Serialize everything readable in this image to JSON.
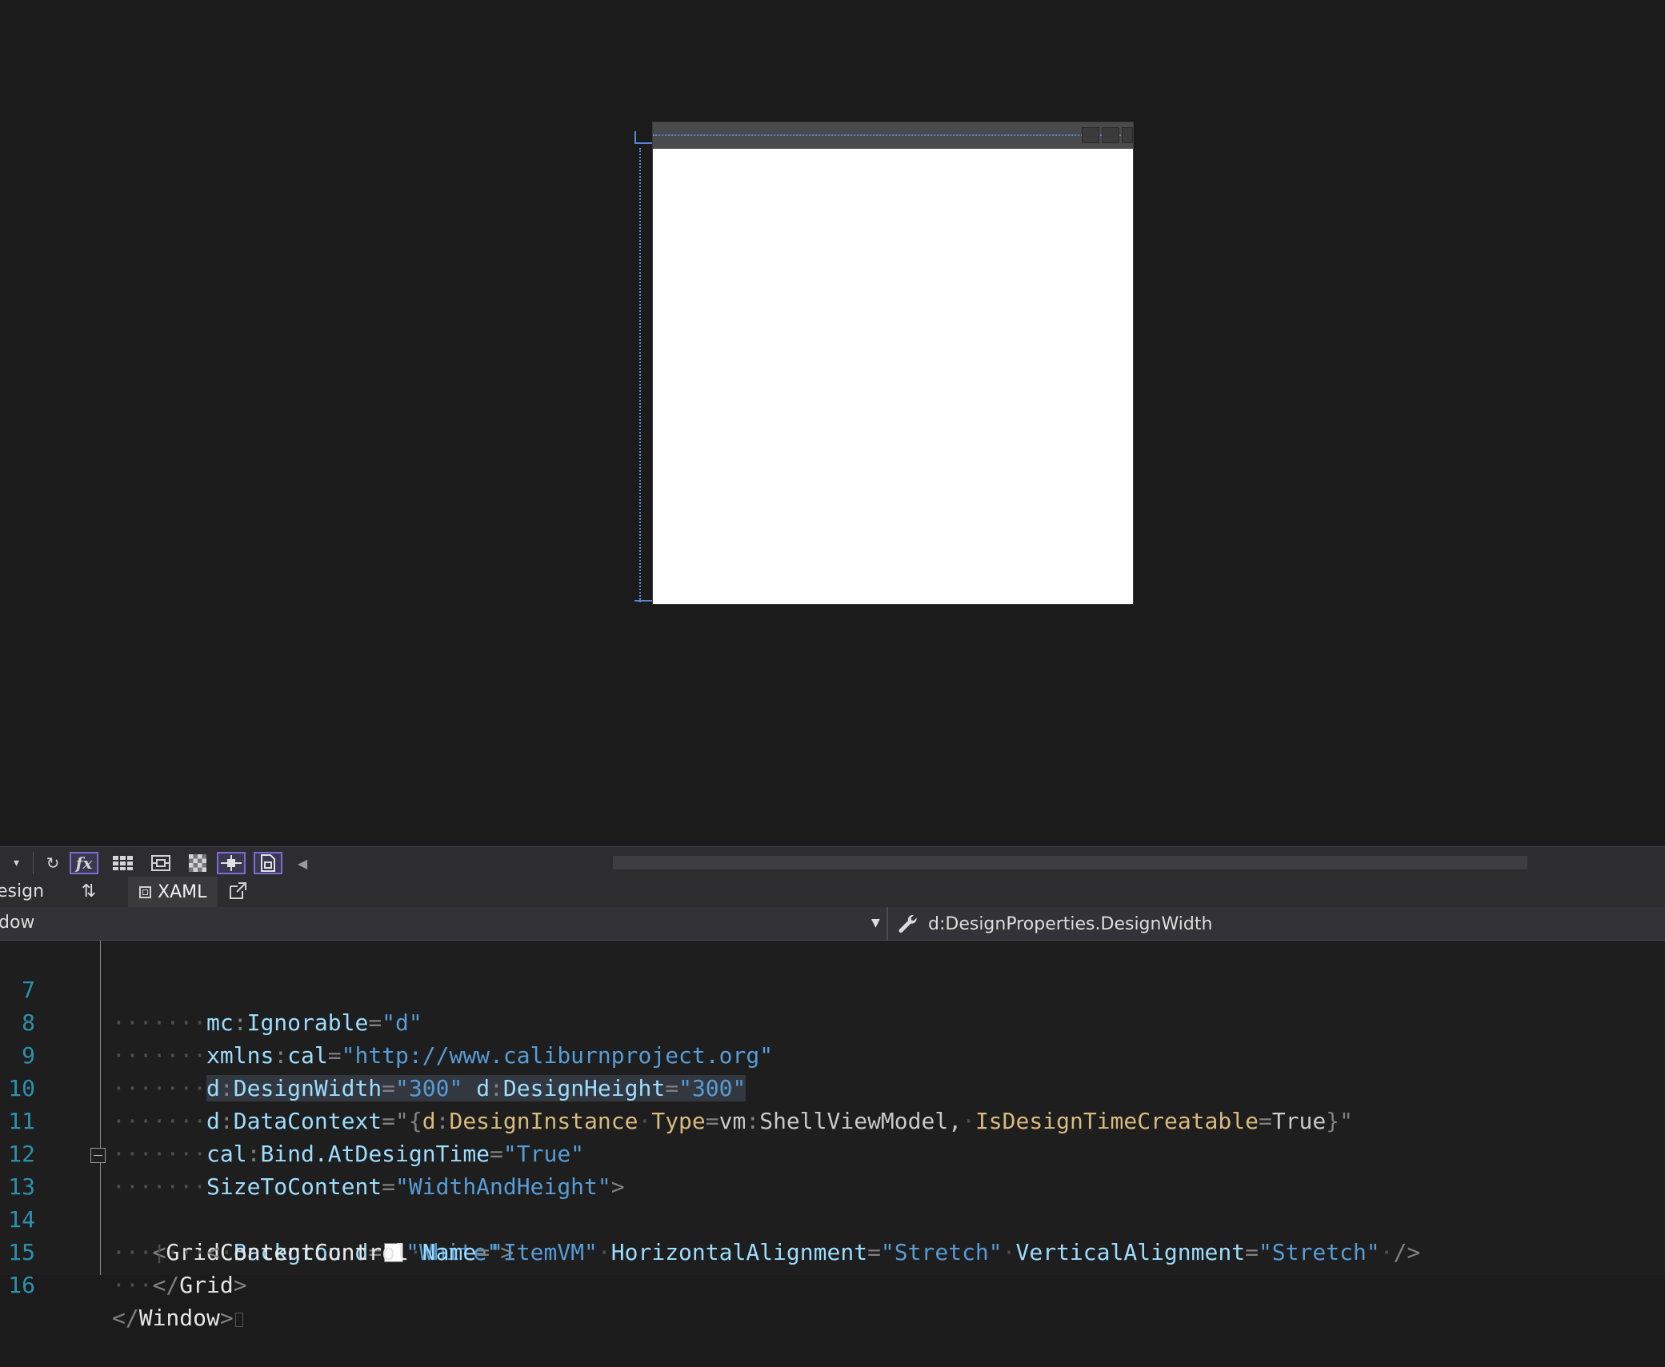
{
  "designer": {
    "preview_window": {
      "title": ""
    }
  },
  "toolbar": {
    "dropdown_icon": "chevron-down-icon",
    "refresh_icon": "refresh-icon",
    "fx_label": "fx",
    "grid_icon": "grid-icon",
    "snap_icon": "snap-to-gridlines-icon",
    "checker_icon": "checkerboard-background-icon",
    "point_icon": "snap-to-snaplines-icon",
    "project_icon": "project-code-icon",
    "scroll_left_icon": "scroll-left-icon"
  },
  "tabs": {
    "design_label": "esign",
    "swap_label": "⇅",
    "xaml_label": "XAML",
    "popout_icon": "popout-icon"
  },
  "navbar": {
    "left_text": "dow",
    "right_text": "d:DesignProperties.DesignWidth"
  },
  "editor": {
    "lines": [
      {
        "n": "7"
      },
      {
        "n": "8"
      },
      {
        "n": "9"
      },
      {
        "n": "10"
      },
      {
        "n": "11"
      },
      {
        "n": "12"
      },
      {
        "n": "13"
      },
      {
        "n": "14"
      },
      {
        "n": "15"
      },
      {
        "n": "16"
      }
    ],
    "l7": {
      "attr_ns": "mc",
      "attr": "Ignorable",
      "val": "\"d\""
    },
    "l8": {
      "attr_ns": "xmlns",
      "attr": "cal",
      "val": "\"http://www.caliburnproject.org\""
    },
    "l9": {
      "a1_ns": "d",
      "a1": "DesignWidth",
      "v1": "\"300\"",
      "a2_ns": "d",
      "a2": "DesignHeight",
      "v2": "\"300\""
    },
    "l10": {
      "attr_ns": "d",
      "attr": "DataContext",
      "open": "\"{",
      "ext_ns": "d",
      "ext": "DesignInstance",
      "k1": "Type",
      "v1_ns": "vm",
      "v1": "ShellViewModel,",
      "k2": "IsDesignTimeCreatable",
      "v2": "True",
      "close": "}\""
    },
    "l11": {
      "attr_ns": "cal",
      "attr": "Bind.AtDesignTime",
      "val": "\"True\""
    },
    "l12": {
      "attr": "SizeToContent",
      "val": "\"WidthAndHeight\"",
      "close": ">"
    },
    "l13": {
      "open": "<",
      "elem": "Grid",
      "attr": "Background",
      "val": "\"White\"",
      "close": ">"
    },
    "l14": {
      "open": "<",
      "elem": "ContentControl",
      "a1": "Name",
      "v1": "\"ItemVM\"",
      "a2": "HorizontalAlignment",
      "v2": "\"Stretch\"",
      "a3": "VerticalAlignment",
      "v3": "\"Stretch\"",
      "close": "/>"
    },
    "l15": {
      "open": "</",
      "elem": "Grid",
      "close": ">"
    },
    "l16": {
      "open": "</",
      "elem": "Window",
      "close": ">"
    }
  },
  "colors": {
    "background": "#1b1b1c",
    "line_number": "#2b91af",
    "attribute": "#9cdcfe",
    "string": "#569cd6",
    "markup_extension": "#d7ba7d",
    "active_toggle_border": "#7c6bd6",
    "selection_guide": "#5a86d9"
  }
}
